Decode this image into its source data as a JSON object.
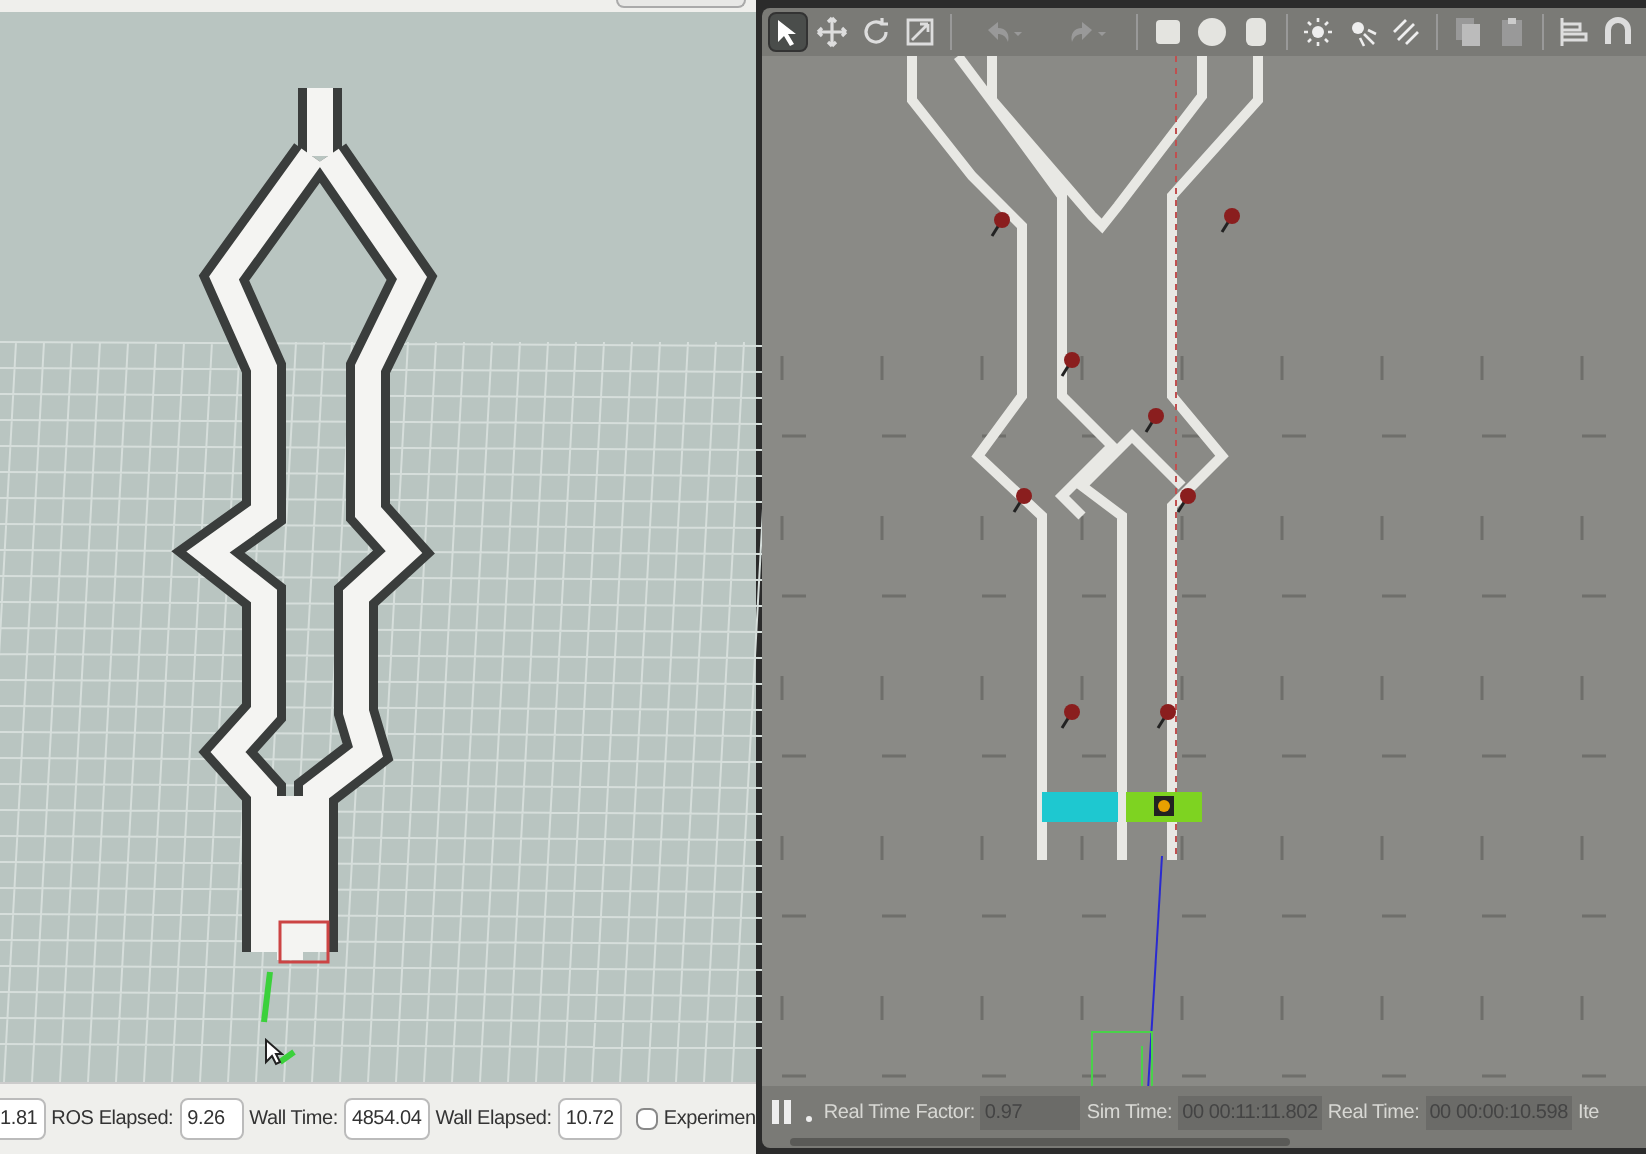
{
  "rviz": {
    "time_bar": {
      "fields": [
        {
          "value": "1.81"
        },
        {
          "label": "ROS Elapsed:",
          "value": "9.26"
        },
        {
          "label": "Wall Time:",
          "value": "4854.04"
        },
        {
          "label": "Wall Elapsed:",
          "value": "10.72"
        }
      ],
      "experimental": {
        "label": "Experimen",
        "checked": false
      }
    }
  },
  "gazebo": {
    "toolbar": [
      {
        "kind": "select",
        "selected": true
      },
      {
        "kind": "translate",
        "selected": false
      },
      {
        "kind": "rotate",
        "selected": false
      },
      {
        "kind": "scale",
        "selected": false
      },
      {
        "kind": "undo",
        "selected": false
      },
      {
        "kind": "redo",
        "selected": false
      },
      {
        "kind": "box",
        "selected": false
      },
      {
        "kind": "sphere",
        "selected": false
      },
      {
        "kind": "cylinder",
        "selected": false
      },
      {
        "kind": "point-light",
        "selected": false
      },
      {
        "kind": "spot-light",
        "selected": false
      },
      {
        "kind": "directional-light",
        "selected": false
      },
      {
        "kind": "copy",
        "selected": false
      },
      {
        "kind": "paste",
        "selected": false
      },
      {
        "kind": "align",
        "selected": false
      },
      {
        "kind": "magnet",
        "selected": false
      }
    ],
    "status_bar": {
      "paused": false,
      "fields": [
        {
          "label": "Real Time Factor:",
          "value": "0.97"
        },
        {
          "label": "Sim Time:",
          "value": "00 00:11:11.802"
        },
        {
          "label": "Real Time:",
          "value": "00 00:00:10.598"
        }
      ],
      "trailing": "Ite"
    }
  }
}
